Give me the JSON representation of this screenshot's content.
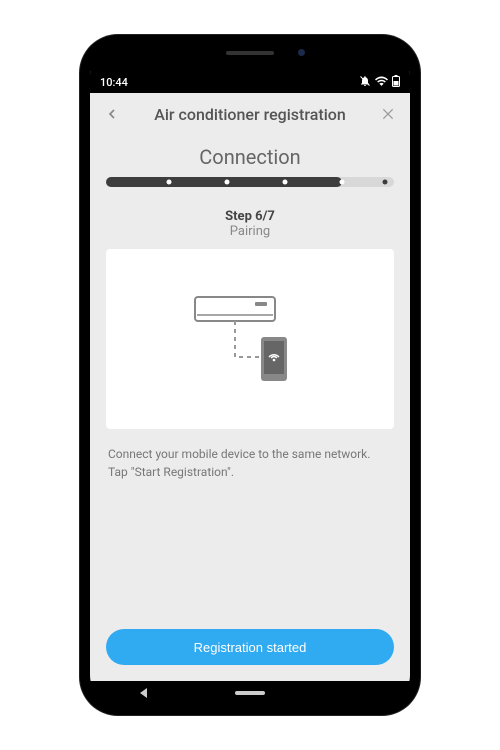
{
  "status": {
    "time": "10:44"
  },
  "header": {
    "title": "Air conditioner registration"
  },
  "section": {
    "title": "Connection"
  },
  "progress": {
    "total_steps": 7,
    "current_step": 6,
    "fill_percent": 82
  },
  "step": {
    "label": "Step 6/7",
    "name": "Pairing"
  },
  "instruction": "Connect your mobile device to the same network. Tap \"Start Registration\".",
  "cta": {
    "label": "Registration started"
  },
  "colors": {
    "accent": "#30aaf0"
  }
}
